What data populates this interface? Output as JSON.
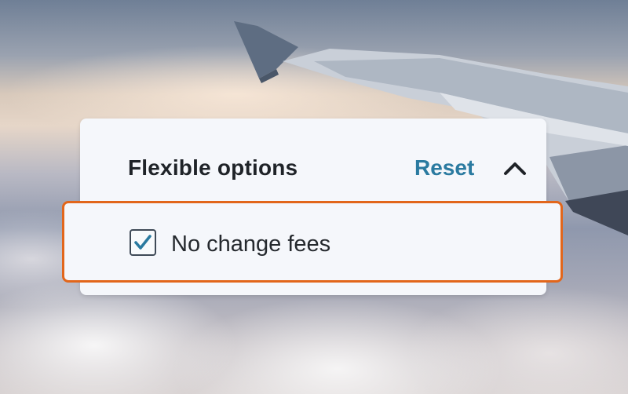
{
  "filter_panel": {
    "title": "Flexible options",
    "reset_label": "Reset",
    "collapse_icon": "chevron-up-icon",
    "options": [
      {
        "label": "No change fees",
        "checked": true
      }
    ]
  },
  "colors": {
    "accent_link": "#2a7aa0",
    "focus_outline": "#e2661b",
    "checkmark": "#2a7aa0"
  }
}
